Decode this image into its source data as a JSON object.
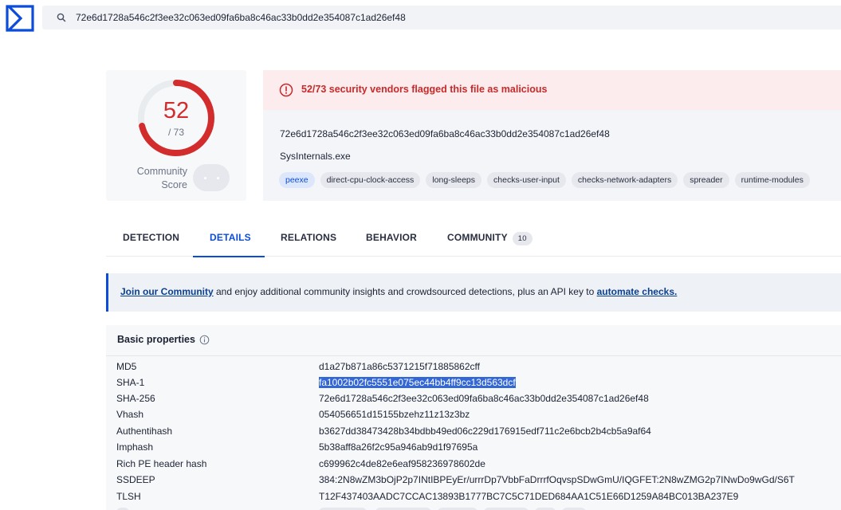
{
  "search": {
    "value": "72e6d1728a546c2f3ee32c063ed09fa6ba8c46ac33b0dd2e354087c1ad26ef48"
  },
  "score": {
    "detected": "52",
    "total": "/ 73",
    "fraction": 0.7123,
    "community_label_1": "Community",
    "community_label_2": "Score"
  },
  "alert": {
    "message": "52/73 security vendors flagged this file as malicious",
    "hash": "72e6d1728a546c2f3ee32c063ed09fa6ba8c46ac33b0dd2e354087c1ad26ef48",
    "filename": "SysInternals.exe",
    "tags": [
      "peexe",
      "direct-cpu-clock-access",
      "long-sleeps",
      "checks-user-input",
      "checks-network-adapters",
      "spreader",
      "runtime-modules"
    ]
  },
  "tabs": {
    "detection": "DETECTION",
    "details": "DETAILS",
    "relations": "RELATIONS",
    "behavior": "BEHAVIOR",
    "community": "COMMUNITY",
    "community_count": "10"
  },
  "banner": {
    "link1": "Join our Community",
    "middle": " and enjoy additional community insights and crowdsourced detections, plus an API key to ",
    "link2": "automate checks."
  },
  "properties": {
    "title": "Basic properties",
    "rows": [
      {
        "key": "MD5",
        "value": "d1a27b871a86c5371215f71885862cff"
      },
      {
        "key": "SHA-1",
        "value": "fa1002b02fc5551e075ec44bb4ff9cc13d563dcf"
      },
      {
        "key": "SHA-256",
        "value": "72e6d1728a546c2f3ee32c063ed09fa6ba8c46ac33b0dd2e354087c1ad26ef48"
      },
      {
        "key": "Vhash",
        "value": "054056651d15155bzehz11z13z3bz"
      },
      {
        "key": "Authentihash",
        "value": "b3627dd38473428b34bdbb49ed06c229d176915edf711c2e6bcb2b4cb5a9af64"
      },
      {
        "key": "Imphash",
        "value": "5b38aff8a26f2c95a946ab9d1f97695a"
      },
      {
        "key": "Rich PE header hash",
        "value": "c699962c4de82e6eaf958236978602de"
      },
      {
        "key": "SSDEEP",
        "value": "384:2N8wZM3bOjP2p7INtIBPEyEr/urrrDp7VbbFaDrrrfOqvspSDwGmU/IQGFET:2N8wZMG2p7INwDo9wGd/S6T"
      },
      {
        "key": "TLSH",
        "value": "T12F437403AADC7CCAC13893B1777BC7C5C71DED684AA1C51E66D1259A84BC013BA237E9"
      }
    ]
  },
  "colors": {
    "accent": "#0b4dda",
    "danger": "#d32c2c"
  },
  "icons": {
    "logo": "virustotal-logo-icon",
    "search": "search-icon",
    "alert": "alert-circle-icon",
    "info": "info-icon"
  }
}
